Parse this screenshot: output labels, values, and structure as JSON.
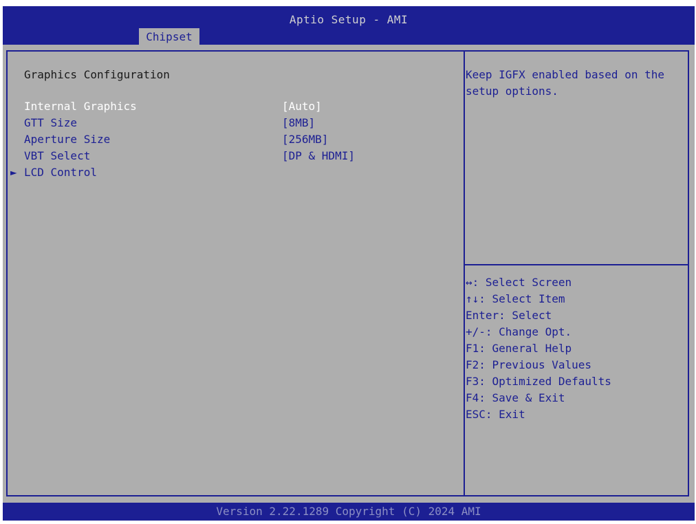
{
  "header": {
    "title": "Aptio Setup - AMI",
    "tabs": [
      {
        "label": "Chipset"
      }
    ]
  },
  "main": {
    "section_title": "Graphics Configuration",
    "settings": [
      {
        "label": "Internal Graphics",
        "value": "[Auto]"
      },
      {
        "label": "GTT Size",
        "value": "[8MB]"
      },
      {
        "label": "Aperture Size",
        "value": "[256MB]"
      },
      {
        "label": "VBT Select",
        "value": "[DP & HDMI]"
      }
    ],
    "submenu": {
      "arrow": "►",
      "label": "LCD Control"
    }
  },
  "help": {
    "text": "Keep IGFX enabled based on the setup options.",
    "keys": [
      "↔: Select Screen",
      "↑↓: Select Item",
      "Enter: Select",
      "+/-: Change Opt.",
      "F1: General Help",
      "F2: Previous Values",
      "F3: Optimized Defaults",
      "F4: Save & Exit",
      "ESC: Exit"
    ]
  },
  "footer": {
    "text": "Version 2.22.1289 Copyright (C) 2024 AMI"
  },
  "colors": {
    "frame_blue": "#1c1f93",
    "panel_gray": "#aeaeae",
    "selected_text": "#ffffff"
  }
}
